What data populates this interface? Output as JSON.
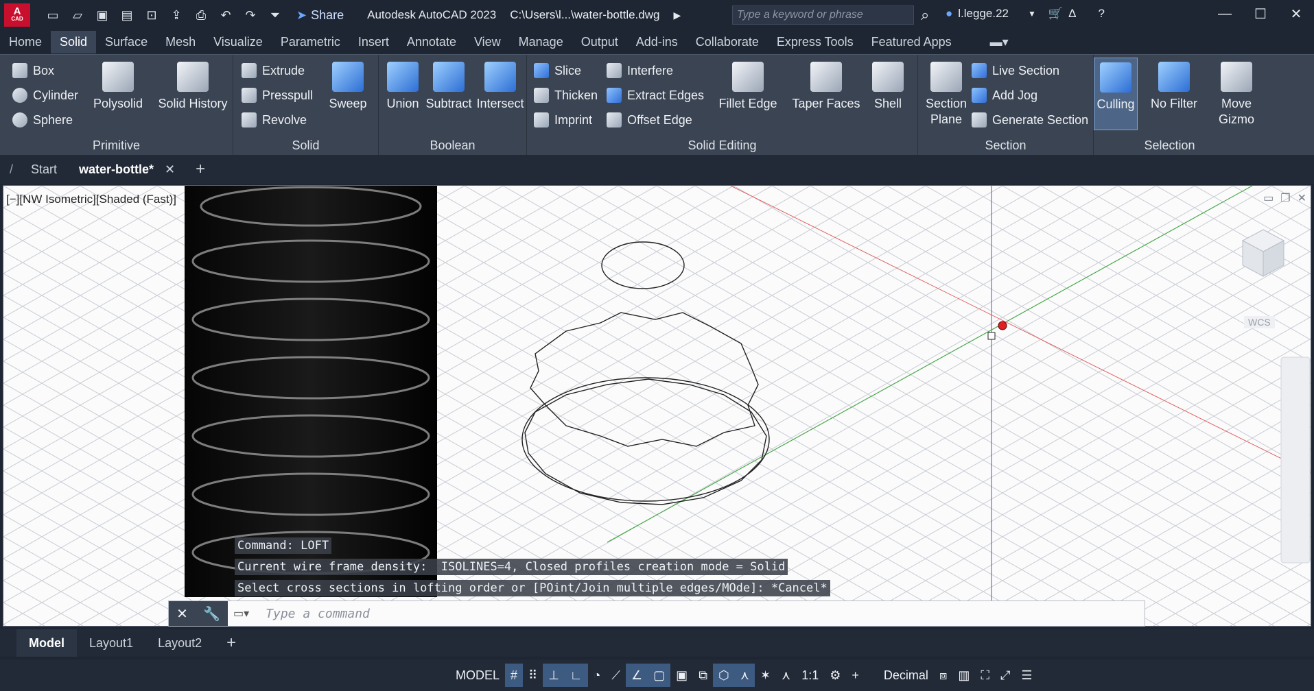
{
  "app": {
    "logo_text": "A",
    "logo_sub": "CAD",
    "share_label": "Share",
    "title": "Autodesk AutoCAD 2023",
    "file_path": "C:\\Users\\l...\\water-bottle.dwg",
    "search_placeholder": "Type a keyword or phrase",
    "username": "l.legge.22"
  },
  "menu_tabs": [
    "Home",
    "Solid",
    "Surface",
    "Mesh",
    "Visualize",
    "Parametric",
    "Insert",
    "Annotate",
    "View",
    "Manage",
    "Output",
    "Add-ins",
    "Collaborate",
    "Express Tools",
    "Featured Apps"
  ],
  "active_menu_tab": "Solid",
  "ribbon": {
    "primitive": {
      "label": "Primitive",
      "box": "Box",
      "cylinder": "Cylinder",
      "sphere": "Sphere",
      "polysolid": "Polysolid",
      "solid_history": "Solid History"
    },
    "solid": {
      "label": "Solid",
      "extrude": "Extrude",
      "presspull": "Presspull",
      "revolve": "Revolve",
      "sweep": "Sweep"
    },
    "boolean": {
      "label": "Boolean",
      "union": "Union",
      "subtract": "Subtract",
      "intersect": "Intersect"
    },
    "solid_editing": {
      "label": "Solid Editing",
      "slice": "Slice",
      "thicken": "Thicken",
      "imprint": "Imprint",
      "interfere": "Interfere",
      "extract_edges": "Extract Edges",
      "offset_edge": "Offset Edge",
      "fillet_edge": "Fillet Edge",
      "taper_faces": "Taper Faces",
      "shell": "Shell"
    },
    "section": {
      "label": "Section",
      "section_plane_1": "Section",
      "section_plane_2": "Plane",
      "live_section": "Live Section",
      "add_jog": "Add Jog",
      "generate_section": "Generate Section"
    },
    "selection": {
      "label": "Selection",
      "culling": "Culling",
      "no_filter": "No Filter",
      "move_gizmo_1": "Move",
      "move_gizmo_2": "Gizmo"
    }
  },
  "doc_tabs": {
    "start": "Start",
    "active": "water-bottle*"
  },
  "viewport": {
    "label": "[−][NW Isometric][Shaded (Fast)]",
    "wcs": "WCS"
  },
  "command": {
    "history": [
      "Command: LOFT",
      "Current wire frame density:  ISOLINES=4, Closed profiles creation mode = Solid",
      "Select cross sections in lofting order or [POint/Join multiple edges/MOde]: *Cancel*"
    ],
    "placeholder": "Type a command"
  },
  "layout_tabs": [
    "Model",
    "Layout1",
    "Layout2"
  ],
  "status": {
    "model": "MODEL",
    "scale": "1:1",
    "units": "Decimal"
  },
  "colors": {
    "ribbon_bg": "#3b4453",
    "title_bg": "#1e2633",
    "accent": "#2c6ed4",
    "viewport_bg": "#fbfbfc"
  }
}
